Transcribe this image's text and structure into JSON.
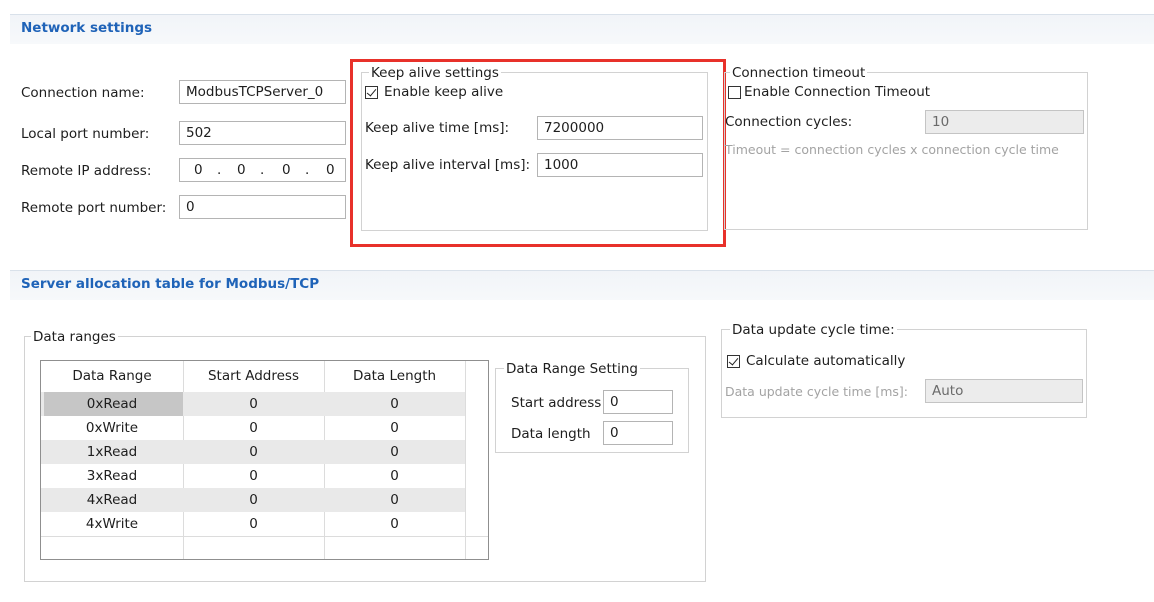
{
  "network": {
    "title": "Network settings",
    "connection_name_label": "Connection name:",
    "connection_name_value": "ModbusTCPServer_0",
    "local_port_label": "Local port number:",
    "local_port_value": "502",
    "remote_ip_label": "Remote IP address:",
    "remote_ip_octets": [
      "0",
      "0",
      "0",
      "0"
    ],
    "remote_port_label": "Remote port number:",
    "remote_port_value": "0"
  },
  "keep_alive": {
    "legend": "Keep alive settings",
    "enable_label": "Enable keep alive",
    "enable_checked": true,
    "time_label": "Keep alive time [ms]:",
    "time_value": "7200000",
    "interval_label": "Keep alive interval [ms]:",
    "interval_value": "1000"
  },
  "timeout": {
    "legend": "Connection timeout",
    "enable_label": "Enable Connection Timeout",
    "enable_checked": false,
    "cycles_label": "Connection cycles:",
    "cycles_value": "10",
    "note": "Timeout = connection cycles x connection cycle time"
  },
  "server": {
    "title": "Server allocation table for Modbus/TCP"
  },
  "data_ranges": {
    "legend": "Data ranges",
    "headers": [
      "Data Range",
      "Start Address",
      "Data Length"
    ],
    "rows": [
      [
        "0xRead",
        "0",
        "0"
      ],
      [
        "0xWrite",
        "0",
        "0"
      ],
      [
        "1xRead",
        "0",
        "0"
      ],
      [
        "3xRead",
        "0",
        "0"
      ],
      [
        "4xRead",
        "0",
        "0"
      ],
      [
        "4xWrite",
        "0",
        "0"
      ]
    ]
  },
  "range_setting": {
    "legend": "Data Range Setting",
    "start_label": "Start address",
    "start_value": "0",
    "length_label": "Data length",
    "length_value": "0"
  },
  "update_cycle": {
    "legend": "Data update cycle time:",
    "auto_label": "Calculate automatically",
    "auto_checked": true,
    "time_label": "Data update cycle time [ms]:",
    "time_value": "Auto"
  },
  "colors": {
    "section_title": "#1f63b8",
    "highlight": "#e8312a"
  }
}
